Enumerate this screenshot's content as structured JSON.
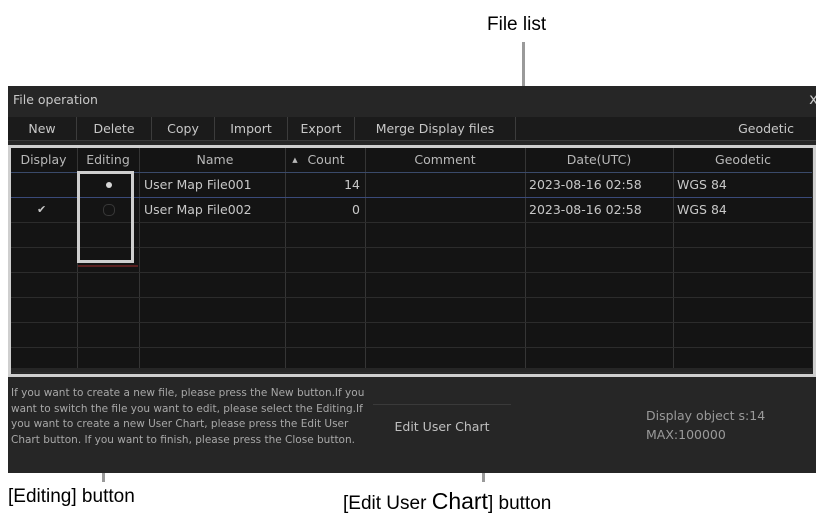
{
  "callouts": {
    "file_list": "File list",
    "editing_button": "[Editing] button",
    "edit_user_chart_button_prefix": "[Edit User ",
    "edit_user_chart_button_word": "Chart",
    "edit_user_chart_button_suffix": "] button"
  },
  "window": {
    "title": "File operation",
    "close": "x"
  },
  "toolbar": {
    "new": "New",
    "delete": "Delete",
    "copy": "Copy",
    "import": "Import",
    "export": "Export",
    "merge": "Merge Display files",
    "geodetic": "Geodetic"
  },
  "table": {
    "headers": {
      "display": "Display",
      "editing": "Editing",
      "name": "Name",
      "count": "Count",
      "comment": "Comment",
      "date": "Date(UTC)",
      "geodetic": "Geodetic"
    },
    "sort_indicator": "▲",
    "rows": [
      {
        "display": "",
        "editing": "selected",
        "name": "User Map File001",
        "count": "14",
        "comment": "",
        "date": "2023-08-16 02:58",
        "geodetic": "WGS 84"
      },
      {
        "display": "✔",
        "editing": "unselected",
        "name": "User Map File002",
        "count": "0",
        "comment": "",
        "date": "2023-08-16 02:58",
        "geodetic": "WGS 84"
      }
    ]
  },
  "help_text": "If you want to create a new file, please press the New button.If you want to switch the file you want to edit, please select the Editing.If you want to create a new User Chart, please press the Edit User Chart button. If you want to finish, please press the Close button.",
  "edit_user_chart": "Edit User Chart",
  "display_objects": "Display object s:14",
  "max_objects": "MAX:100000"
}
